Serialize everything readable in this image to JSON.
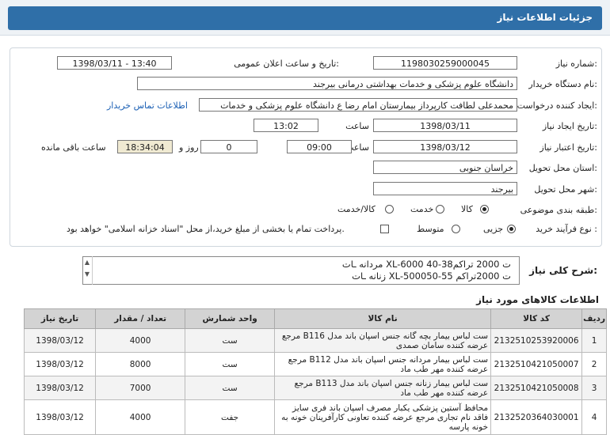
{
  "header": {
    "title": "جزئیات اطلاعات نیاز"
  },
  "form": {
    "need_number_label": "شماره نیاز:",
    "need_number": "1198030259000045",
    "announce_label": "تاریخ و ساعت اعلان عمومی:",
    "announce_value": "1398/03/11 - 13:40",
    "buyer_label": "نام دستگاه خریدار:",
    "buyer_value": "دانشگاه علوم پزشکی و خدمات بهداشتی درمانی بیرجند",
    "creator_label": "ایجاد کننده درخواست:",
    "creator_value": "محمدعلی لطافت کارپرداز بیمارستان امام رضا ع دانشگاه علوم پزشکی و خدمات",
    "contact_link": "اطلاعات تماس خریدار",
    "created_date_label": "تاریخ ایجاد نیاز:",
    "created_date": "1398/03/11",
    "time_label": "ساعت",
    "created_time": "13:02",
    "validity_label": "تاریخ اعتبار نیاز:",
    "validity_date": "1398/03/12",
    "validity_time": "09:00",
    "days": "0",
    "days_label": "روز و",
    "remaining": "18:34:04",
    "remaining_label": "ساعت باقی مانده",
    "province_label": "استان محل تحویل:",
    "province": "خراسان جنوبی",
    "city_label": "شهر محل تحویل:",
    "city": "بیرجند",
    "category_label": "طبقه بندی موضوعی:",
    "category_options": [
      "کالا",
      "خدمت",
      "کالا/خدمت"
    ],
    "process_label": "نوع فرآیند خرید :",
    "process_options": [
      "جزیی",
      "متوسط"
    ],
    "payment_note": "پرداخت تمام یا بخشی از مبلغ خرید،از محل \"اسناد خزانه اسلامی\" خواهد بود."
  },
  "description": {
    "label": "شرح کلی نیاز:",
    "line1": "مردانه ـات XL-6000 ت 2000 تراکم38-40",
    "line2": "زنانه ـات XL-5000ت 2000تراکم 55-50"
  },
  "items_section": {
    "title": "اطلاعات کالاهای مورد نیاز",
    "headers": [
      "ردیف",
      "کد کالا",
      "نام کالا",
      "واحد شمارش",
      "تعداد / مقدار",
      "تاریخ نیاز"
    ],
    "rows": [
      {
        "row": "1",
        "code": "2132510253920006",
        "name": "ست لباس بیمار بچه گانه جنس اسپان باند مدل B116 مرجع عرضه کننده سامان صمدی",
        "unit": "ست",
        "qty": "4000",
        "date": "1398/03/12"
      },
      {
        "row": "2",
        "code": "2132510421050007",
        "name": "ست لباس بیمار مردانه جنس اسپان باند مدل B112 مرجع عرضه کننده مهر طب ماد",
        "unit": "ست",
        "qty": "8000",
        "date": "1398/03/12"
      },
      {
        "row": "3",
        "code": "2132510421050008",
        "name": "ست لباس بیمار زنانه جنس اسپان باند مدل B113 مرجع عرضه کننده مهر طب ماد",
        "unit": "ست",
        "qty": "7000",
        "date": "1398/03/12"
      },
      {
        "row": "4",
        "code": "2132520364030001",
        "name": "محافظ آستین پزشکی یکبار مصرف اسپان باند فری سایز فاقد نام تجاری مرجع عرضه کننده تعاونی کارآفرینان خونه به خونه پارسه",
        "unit": "جفت",
        "qty": "4000",
        "date": "1398/03/12"
      }
    ]
  }
}
